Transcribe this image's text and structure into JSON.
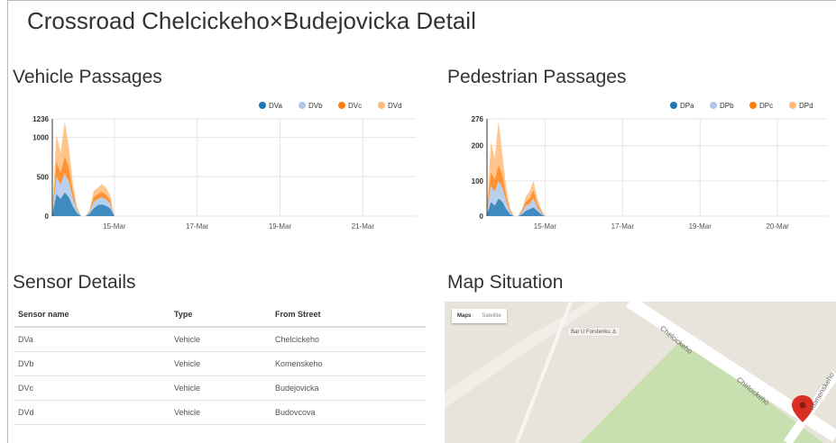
{
  "page": {
    "title": "Crossroad Chelcickeho×Budejovicka Detail"
  },
  "vehicle_chart": {
    "section_title": "Vehicle Passages",
    "legend": [
      {
        "label": "DVa",
        "color": "#1f77b4"
      },
      {
        "label": "DVb",
        "color": "#aec7e8"
      },
      {
        "label": "DVc",
        "color": "#ff7f0e"
      },
      {
        "label": "DVd",
        "color": "#ffbb78"
      }
    ]
  },
  "pedestrian_chart": {
    "section_title": "Pedestrian Passages",
    "legend": [
      {
        "label": "DPa",
        "color": "#1f77b4"
      },
      {
        "label": "DPb",
        "color": "#aec7e8"
      },
      {
        "label": "DPc",
        "color": "#ff7f0e"
      },
      {
        "label": "DPd",
        "color": "#ffbb78"
      }
    ]
  },
  "chart_data": [
    {
      "type": "area",
      "stacked": true,
      "grid": true,
      "legend_position": "top-right",
      "x_tick_labels": [
        "15-Mar",
        "17-Mar",
        "19-Mar",
        "21-Mar"
      ],
      "x_ticks_day": [
        15,
        17,
        19,
        21
      ],
      "x_range_day": [
        13.5,
        22.3
      ],
      "y_tick_labels": [
        "0",
        "500",
        "1000",
        "1236"
      ],
      "y_ticks": [
        0,
        500,
        1000,
        1236
      ],
      "ylim": [
        0,
        1236
      ],
      "x_day": [
        13.5,
        13.6,
        13.7,
        13.8,
        13.9,
        14.0,
        14.1,
        14.2,
        14.3,
        14.4,
        14.5,
        14.6,
        14.7,
        14.8,
        14.9,
        15.0
      ],
      "series": [
        {
          "name": "DVa",
          "color": "#1f77b4",
          "values": [
            20,
            280,
            220,
            300,
            240,
            120,
            40,
            0,
            0,
            30,
            100,
            140,
            150,
            130,
            100,
            0
          ]
        },
        {
          "name": "DVb",
          "color": "#aec7e8",
          "values": [
            20,
            220,
            180,
            240,
            200,
            100,
            30,
            0,
            0,
            25,
            80,
            80,
            90,
            80,
            60,
            0
          ]
        },
        {
          "name": "DVc",
          "color": "#ff7f0e",
          "values": [
            10,
            200,
            150,
            220,
            180,
            80,
            20,
            0,
            0,
            10,
            60,
            60,
            70,
            60,
            40,
            0
          ]
        },
        {
          "name": "DVd",
          "color": "#ffbb78",
          "values": [
            20,
            340,
            250,
            440,
            260,
            100,
            20,
            0,
            0,
            15,
            80,
            80,
            100,
            90,
            60,
            0
          ]
        }
      ]
    },
    {
      "type": "area",
      "stacked": true,
      "grid": true,
      "legend_position": "top-right",
      "x_tick_labels": [
        "15-Mar",
        "17-Mar",
        "19-Mar",
        "20-Mar"
      ],
      "x_ticks_day": [
        15,
        17,
        19,
        21
      ],
      "x_range_day": [
        13.5,
        22.3
      ],
      "y_tick_labels": [
        "0",
        "100",
        "200",
        "276"
      ],
      "y_ticks": [
        0,
        100,
        200,
        276
      ],
      "ylim": [
        0,
        276
      ],
      "x_day": [
        13.5,
        13.6,
        13.7,
        13.8,
        13.9,
        14.0,
        14.1,
        14.2,
        14.3,
        14.4,
        14.5,
        14.6,
        14.7,
        14.8,
        14.9,
        15.0
      ],
      "series": [
        {
          "name": "DPa",
          "color": "#1f77b4",
          "values": [
            5,
            40,
            30,
            50,
            40,
            20,
            5,
            0,
            0,
            5,
            15,
            20,
            25,
            15,
            5,
            0
          ]
        },
        {
          "name": "DPb",
          "color": "#aec7e8",
          "values": [
            5,
            45,
            40,
            50,
            40,
            20,
            5,
            0,
            0,
            5,
            15,
            15,
            25,
            10,
            5,
            0
          ]
        },
        {
          "name": "DPc",
          "color": "#ff7f0e",
          "values": [
            5,
            40,
            35,
            45,
            35,
            15,
            5,
            0,
            0,
            5,
            10,
            15,
            25,
            10,
            5,
            0
          ]
        },
        {
          "name": "DPd",
          "color": "#ffbb78",
          "values": [
            5,
            85,
            60,
            125,
            55,
            25,
            5,
            0,
            0,
            5,
            15,
            20,
            25,
            15,
            5,
            0
          ]
        }
      ]
    }
  ],
  "sensors": {
    "section_title": "Sensor Details",
    "columns": [
      "Sensor name",
      "Type",
      "From Street"
    ],
    "rows": [
      [
        "DVa",
        "Vehicle",
        "Chelcickeho"
      ],
      [
        "DVb",
        "Vehicle",
        "Komenskeho"
      ],
      [
        "DVc",
        "Vehicle",
        "Budejovicka"
      ],
      [
        "DVd",
        "Vehicle",
        "Budovcova"
      ]
    ]
  },
  "map": {
    "section_title": "Map Situation",
    "tabs": [
      {
        "label": "Maps",
        "active": true
      },
      {
        "label": "Satellite",
        "active": false
      }
    ],
    "place_label": "Bar U Forstenku ⚓",
    "street_labels": [
      "Chelcickeho",
      "Chelcickeho",
      "Komenskeho"
    ],
    "colors": {
      "park": "#c8e0b0",
      "road": "#ffffff",
      "land": "#e8e4dc",
      "marker": "#d93025"
    }
  }
}
